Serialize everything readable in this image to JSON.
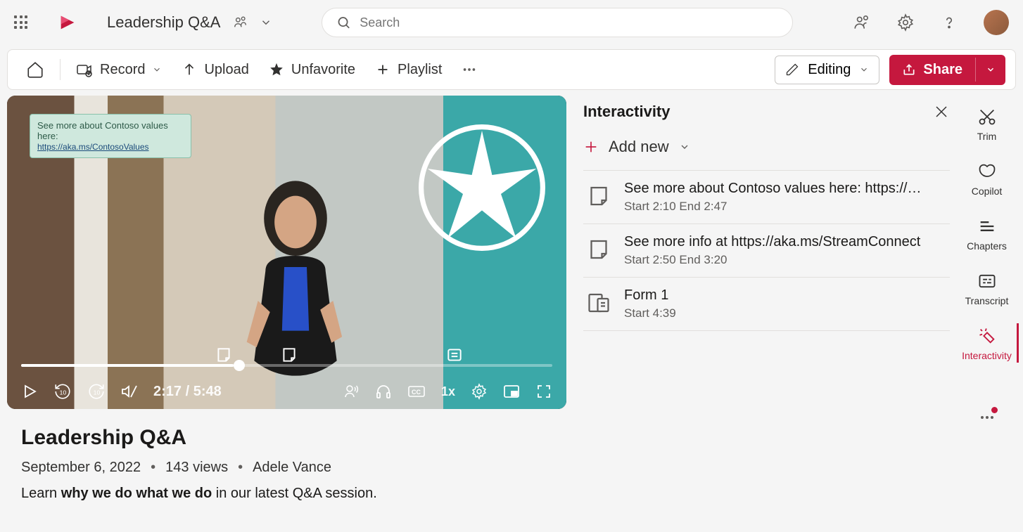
{
  "header": {
    "title": "Leadership Q&A",
    "search_placeholder": "Search"
  },
  "commands": {
    "record": "Record",
    "upload": "Upload",
    "unfavorite": "Unfavorite",
    "playlist": "Playlist",
    "mode": "Editing",
    "share": "Share"
  },
  "video": {
    "callout_text": "See more about Contoso values here:",
    "callout_link": "https://aka.ms/ContosoValues",
    "current_time": "2:17",
    "duration": "5:48",
    "speed": "1x",
    "title": "Leadership Q&A",
    "date": "September 6, 2022",
    "views": "143 views",
    "author": "Adele Vance",
    "description_pre": "Learn ",
    "description_bold": "why we do what we do",
    "description_post": " in our latest Q&A session."
  },
  "panel": {
    "title": "Interactivity",
    "add_new": "Add new",
    "items": [
      {
        "title": "See more about Contoso values here: https://…",
        "sub": "Start 2:10 End 2:47",
        "type": "note"
      },
      {
        "title": "See more info at https://aka.ms/StreamConnect",
        "sub": "Start 2:50 End 3:20",
        "type": "note"
      },
      {
        "title": "Form 1",
        "sub": "Start 4:39",
        "type": "form"
      }
    ]
  },
  "rail": {
    "trim": "Trim",
    "copilot": "Copilot",
    "chapters": "Chapters",
    "transcript": "Transcript",
    "interactivity": "Interactivity"
  }
}
